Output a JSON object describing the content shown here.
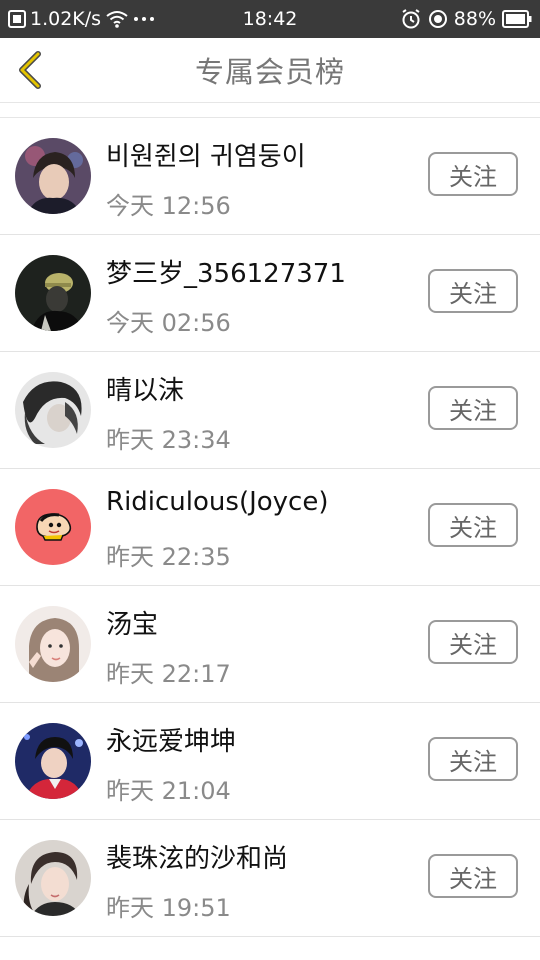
{
  "status_bar": {
    "net_speed": "1.02K/s",
    "time": "18:42",
    "battery": "88%"
  },
  "header": {
    "title": "专属会员榜"
  },
  "colors": {
    "accent": "#e4c400",
    "status_bar_bg": "#3a3a3a",
    "title": "#777777",
    "name": "#111111",
    "time": "#8a8a8a",
    "button_border": "#9a9a9a"
  },
  "members": [
    {
      "name": "비원쥔의 귀염둥이",
      "time": "今天 12:56",
      "follow_label": "关注"
    },
    {
      "name": "梦三岁_356127371",
      "time": "今天 02:56",
      "follow_label": "关注"
    },
    {
      "name": "晴以沫",
      "time": "昨天 23:34",
      "follow_label": "关注"
    },
    {
      "name": "Ridiculous(Joyce)",
      "time": "昨天 22:35",
      "follow_label": "关注"
    },
    {
      "name": "汤宝",
      "time": "昨天 22:17",
      "follow_label": "关注"
    },
    {
      "name": "永远爱坤坤",
      "time": "昨天 21:04",
      "follow_label": "关注"
    },
    {
      "name": "裴珠泫的沙和尚",
      "time": "昨天 19:51",
      "follow_label": "关注"
    }
  ]
}
